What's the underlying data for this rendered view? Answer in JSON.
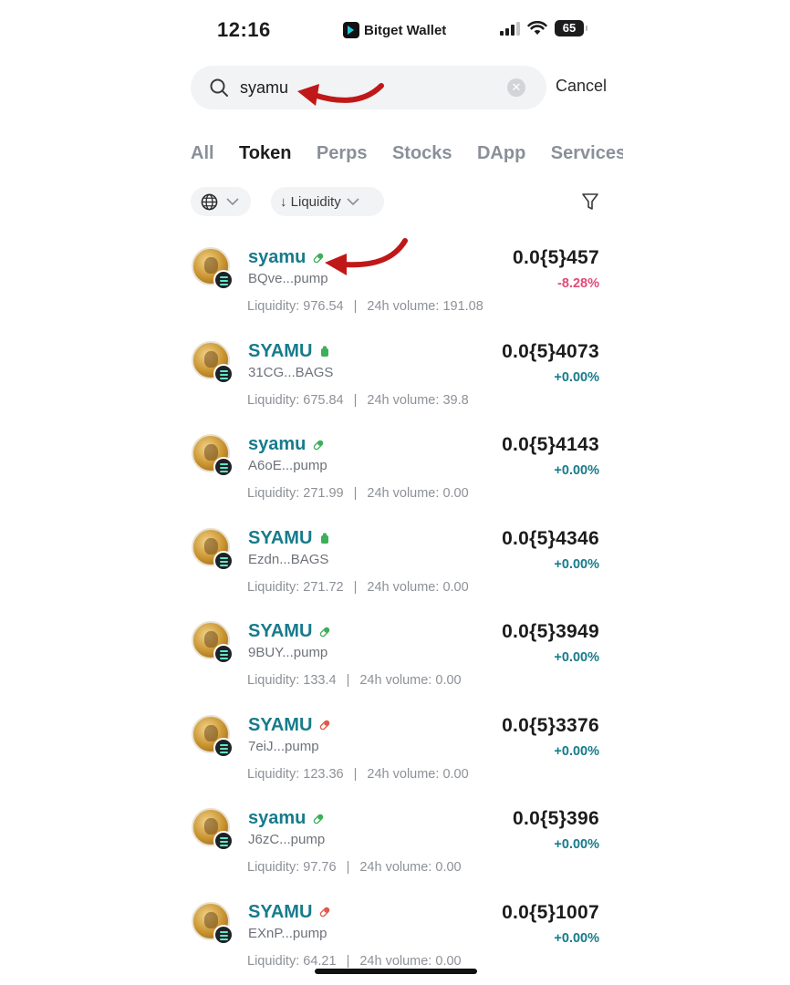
{
  "status_bar": {
    "time": "12:16",
    "app_name": "Bitget Wallet",
    "battery": "65"
  },
  "search": {
    "value": "syamu",
    "placeholder": "",
    "cancel_label": "Cancel"
  },
  "tabs": [
    {
      "label": "All",
      "active": false
    },
    {
      "label": "Token",
      "active": true
    },
    {
      "label": "Perps",
      "active": false
    },
    {
      "label": "Stocks",
      "active": false
    },
    {
      "label": "DApp",
      "active": false
    },
    {
      "label": "Services",
      "active": false
    }
  ],
  "filters": {
    "sort_label": "↓ Liquidity"
  },
  "labels": {
    "liquidity": "Liquidity:",
    "volume": "24h volume:"
  },
  "colors": {
    "accent": "#177b8b",
    "negative": "#e24a78",
    "annotation_arrow": "#c01818"
  },
  "tokens": [
    {
      "name": "syamu",
      "tag_icon": "pill-icon-green",
      "address": "BQve...pump",
      "liquidity": "976.54",
      "volume": "191.08",
      "price": "0.0{5}457",
      "change": "-8.28%",
      "change_dir": "down"
    },
    {
      "name": "SYAMU",
      "tag_icon": "bag-icon-green",
      "address": "31CG...BAGS",
      "liquidity": "675.84",
      "volume": "39.8",
      "price": "0.0{5}4073",
      "change": "+0.00%",
      "change_dir": "flat"
    },
    {
      "name": "syamu",
      "tag_icon": "pill-icon-green",
      "address": "A6oE...pump",
      "liquidity": "271.99",
      "volume": "0.00",
      "price": "0.0{5}4143",
      "change": "+0.00%",
      "change_dir": "flat"
    },
    {
      "name": "SYAMU",
      "tag_icon": "bag-icon-green",
      "address": "Ezdn...BAGS",
      "liquidity": "271.72",
      "volume": "0.00",
      "price": "0.0{5}4346",
      "change": "+0.00%",
      "change_dir": "flat"
    },
    {
      "name": "SYAMU",
      "tag_icon": "pill-icon-green",
      "address": "9BUY...pump",
      "liquidity": "133.4",
      "volume": "0.00",
      "price": "0.0{5}3949",
      "change": "+0.00%",
      "change_dir": "flat"
    },
    {
      "name": "SYAMU",
      "tag_icon": "pill-icon-red",
      "address": "7eiJ...pump",
      "liquidity": "123.36",
      "volume": "0.00",
      "price": "0.0{5}3376",
      "change": "+0.00%",
      "change_dir": "flat"
    },
    {
      "name": "syamu",
      "tag_icon": "pill-icon-green",
      "address": "J6zC...pump",
      "liquidity": "97.76",
      "volume": "0.00",
      "price": "0.0{5}396",
      "change": "+0.00%",
      "change_dir": "flat"
    },
    {
      "name": "SYAMU",
      "tag_icon": "pill-icon-red",
      "address": "EXnP...pump",
      "liquidity": "64.21",
      "volume": "0.00",
      "price": "0.0{5}1007",
      "change": "+0.00%",
      "change_dir": "flat"
    }
  ]
}
